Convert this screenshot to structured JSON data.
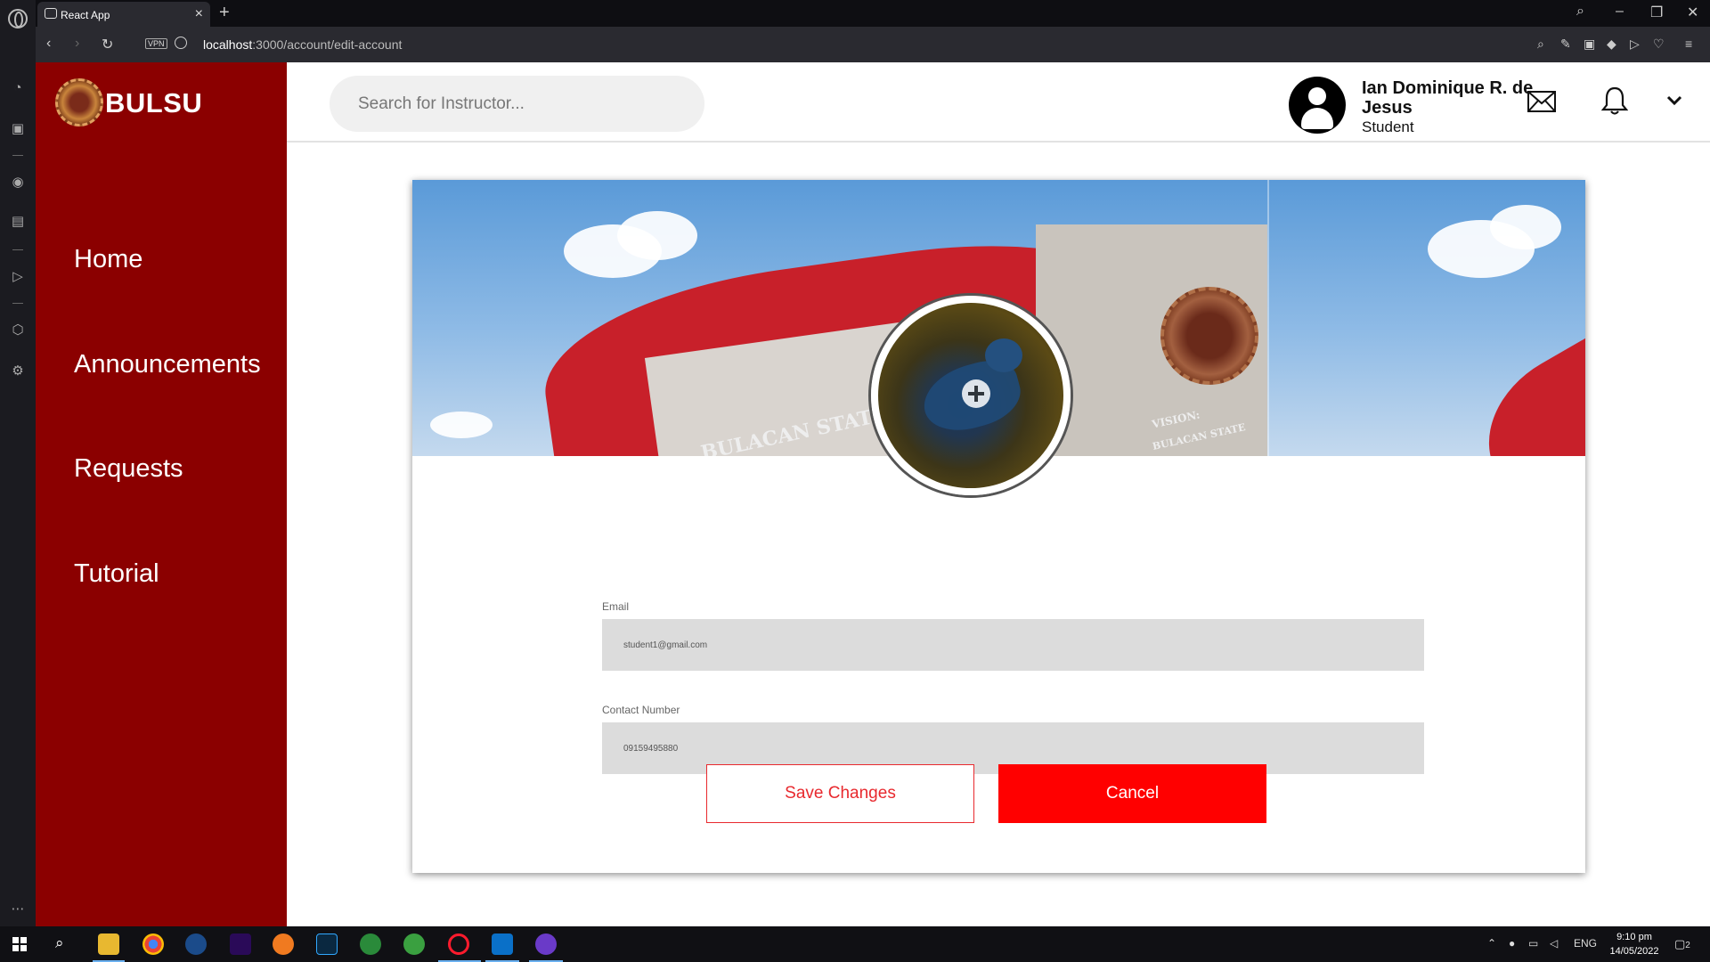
{
  "browser": {
    "tab_title": "React App",
    "url_host": "localhost",
    "url_path": ":3000/account/edit-account",
    "vpn_label": "VPN"
  },
  "app": {
    "brand": "BULSU",
    "nav": [
      {
        "label": "Home"
      },
      {
        "label": "Announcements"
      },
      {
        "label": "Requests"
      },
      {
        "label": "Tutorial"
      }
    ],
    "search": {
      "placeholder": "Search for Instructor..."
    },
    "user": {
      "name": "Ian Dominique R. de Jesus",
      "role": "Student"
    },
    "form": {
      "email_label": "Email",
      "email_value": "student1@gmail.com",
      "contact_label": "Contact Number",
      "contact_value": "09159495880",
      "save_label": "Save Changes",
      "cancel_label": "Cancel"
    },
    "banner_texts": {
      "school": "BULACAN STATE",
      "vision": "VISION:",
      "vision_sub": "BULACAN STATE"
    }
  },
  "taskbar": {
    "lang": "ENG",
    "time": "9:10 pm",
    "date": "14/05/2022",
    "notifications": "2"
  },
  "colors": {
    "sidebar": "#8b0000",
    "accent": "#ff0000",
    "field_bg": "#dcdcdc"
  }
}
